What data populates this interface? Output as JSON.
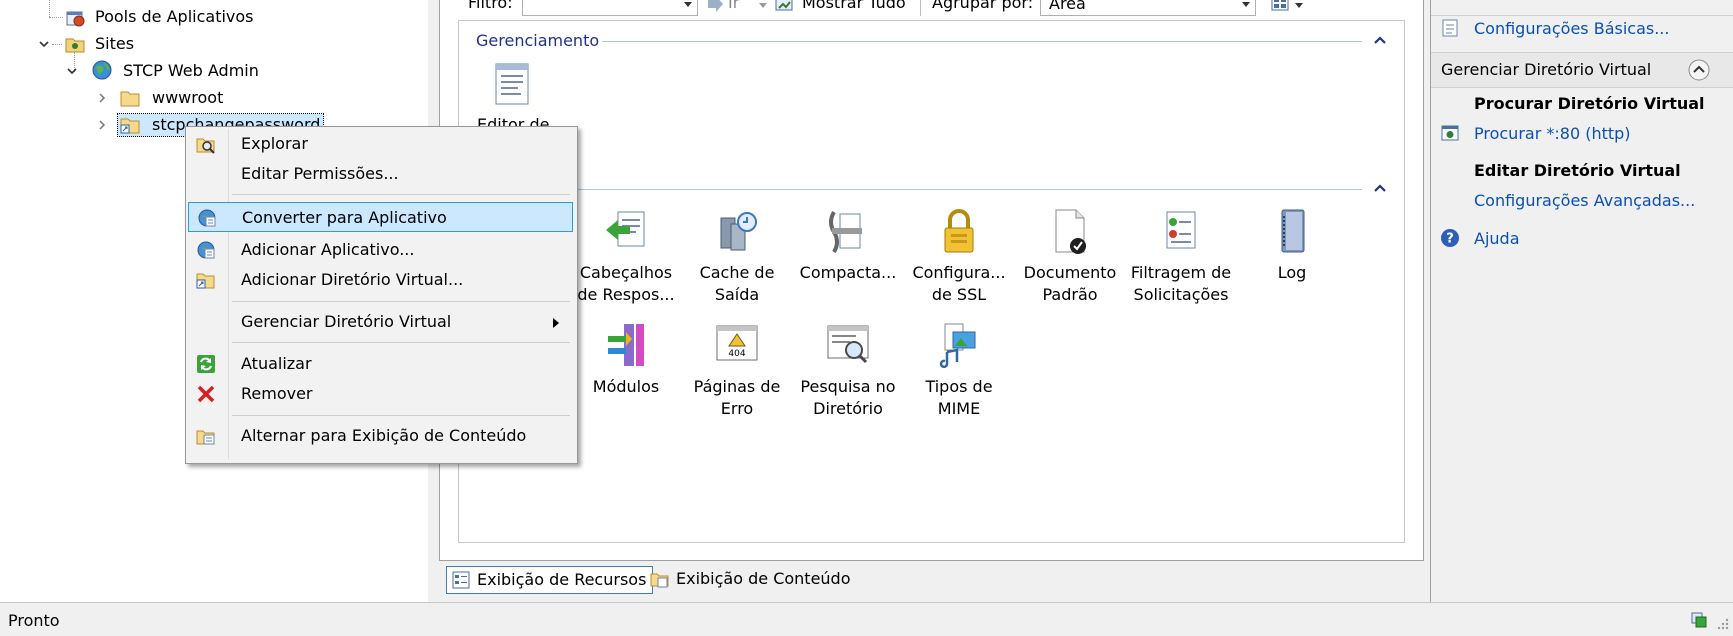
{
  "tree": {
    "items": [
      {
        "label": "Pools de Aplicativos"
      },
      {
        "label": "Sites"
      },
      {
        "label": "STCP Web Admin"
      },
      {
        "label": "wwwroot"
      },
      {
        "label": "stcpchangepassword"
      }
    ]
  },
  "toolbar": {
    "filter_label": "Filtro:",
    "go_label": "Ir",
    "show_all_label": "Mostrar Tudo",
    "group_by_label": "Agrupar por:",
    "group_by_value": "Área"
  },
  "groups": {
    "management_title": "Gerenciamento",
    "management_items": [
      {
        "label": "Editor de"
      }
    ]
  },
  "features": [
    {
      "label": "Cabeçalhos de Respos..."
    },
    {
      "label": "Cache de Saída"
    },
    {
      "label": "Compacta..."
    },
    {
      "label": "Configura... de SSL"
    },
    {
      "label": "Documento Padrão"
    },
    {
      "label": "Filtragem de Solicitações"
    },
    {
      "label": "Log"
    },
    {
      "label": "Módulos"
    },
    {
      "label": "Páginas de Erro"
    },
    {
      "label": "Pesquisa no Diretório"
    },
    {
      "label": "Tipos de MIME"
    }
  ],
  "view_tabs": {
    "features_view": "Exibição de Recursos",
    "content_view": "Exibição de Conteúdo"
  },
  "actions": {
    "basic_settings": "Configurações Básicas...",
    "manage_vdir_title": "Gerenciar Diretório Virtual",
    "browse_vdir_head": "Procurar Diretório Virtual",
    "browse_link": "Procurar *:80 (http)",
    "edit_vdir_head": "Editar Diretório Virtual",
    "advanced_settings": "Configurações Avançadas...",
    "help": "Ajuda"
  },
  "status": {
    "text": "Pronto"
  },
  "context_menu": {
    "items": [
      {
        "label": "Explorar"
      },
      {
        "label": "Editar Permissões..."
      },
      {
        "label": "Converter para Aplicativo"
      },
      {
        "label": "Adicionar Aplicativo..."
      },
      {
        "label": "Adicionar Diretório Virtual..."
      },
      {
        "label": "Gerenciar Diretório Virtual"
      },
      {
        "label": "Atualizar"
      },
      {
        "label": "Remover"
      },
      {
        "label": "Alternar para Exibição de Conteúdo"
      }
    ],
    "highlighted_index": 2
  },
  "colors": {
    "link": "#0a50b4",
    "group_title": "#1e3287",
    "highlight_bg": "#cce8ff",
    "highlight_border": "#26a0da"
  }
}
